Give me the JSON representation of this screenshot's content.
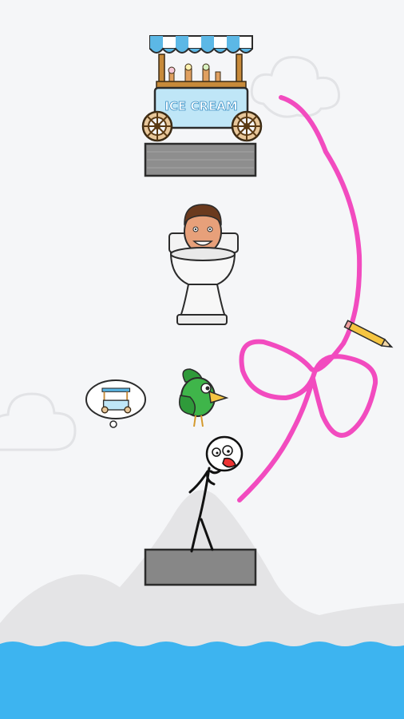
{
  "game": {
    "cart_sign": "ICE CREAM",
    "colors": {
      "background": "#f5f6f8",
      "water": "#3db4f0",
      "hill": "#e4e4e6",
      "platform": "#8a8a8a",
      "drawn_line": "#f24bbf",
      "cart_body": "#bfe6f7",
      "awning_blue": "#5cb8e6",
      "bird": "#3fb54a"
    },
    "objects": [
      "ice-cream-cart",
      "toilet-head-character",
      "green-bird",
      "stickman",
      "thought-bubble-cart",
      "drawn-pink-line",
      "pencil"
    ]
  }
}
